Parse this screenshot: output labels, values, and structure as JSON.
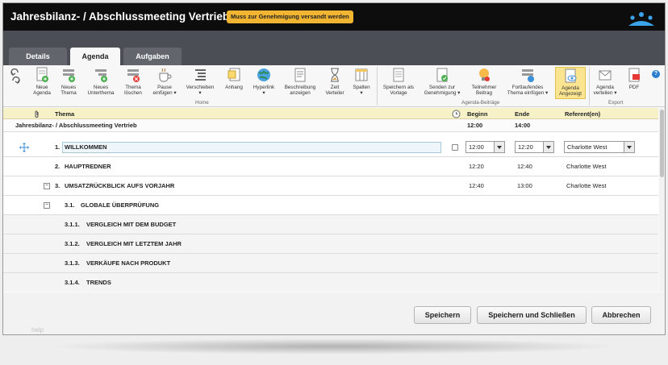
{
  "window": {
    "title": "Jahresbilanz- / Abschlussmeeting Vertrieb",
    "badge": "Muss zur Genehmigung versandt werden"
  },
  "tabs": [
    {
      "label": "Details",
      "active": false
    },
    {
      "label": "Agenda",
      "active": true
    },
    {
      "label": "Aufgaben",
      "active": false
    }
  ],
  "ribbon": {
    "buttons": [
      {
        "label1": "Neue",
        "label2": "Agenda",
        "icon": "new-agenda-icon"
      },
      {
        "label1": "Neues",
        "label2": "Thema",
        "icon": "new-topic-icon"
      },
      {
        "label1": "Neues",
        "label2": "Unterthema",
        "icon": "new-subtopic-icon"
      },
      {
        "label1": "Thema",
        "label2": "löschen",
        "icon": "delete-topic-icon"
      },
      {
        "label1": "Pause",
        "label2": "einfügen ▾",
        "icon": "coffee-break-icon"
      },
      {
        "label1": "Verschieben",
        "label2": "▾",
        "icon": "move-icon"
      },
      {
        "label1": "Anhang",
        "label2": "",
        "icon": "attachment-icon"
      },
      {
        "label1": "Hyperlink",
        "label2": "▾",
        "icon": "hyperlink-globe-icon"
      },
      {
        "label1": "Beschreibung",
        "label2": "anzeigen",
        "icon": "description-icon"
      },
      {
        "label1": "Zeit",
        "label2": "Verteiler",
        "icon": "hourglass-icon"
      },
      {
        "label1": "Spalten",
        "label2": "▾",
        "icon": "columns-icon"
      },
      {
        "label1": "Speichern als",
        "label2": "Vorlage",
        "icon": "save-template-icon"
      },
      {
        "label1": "Senden zur",
        "label2": "Genehmigung ▾",
        "icon": "send-approval-icon"
      },
      {
        "label1": "Teilnehmer",
        "label2": "Beitrag",
        "icon": "participant-bulb-icon"
      },
      {
        "label1": "Fortlaufendes",
        "label2": "Thema einfügen ▾",
        "icon": "recurring-topic-icon"
      },
      {
        "label1": "Agenda",
        "label2": "Angezeigt",
        "icon": "agenda-shown-icon"
      },
      {
        "label1": "Agenda",
        "label2": "verteilen ▾",
        "icon": "distribute-agenda-icon"
      },
      {
        "label1": "PDF",
        "label2": "",
        "icon": "pdf-icon"
      }
    ],
    "groups": {
      "home": "Home",
      "contrib": "Agenda-Beiträge",
      "export": "Export"
    },
    "help": "?"
  },
  "table": {
    "headers": {
      "thema": "Thema",
      "beginn": "Beginn",
      "ende": "Ende",
      "referent": "Referent(en)"
    },
    "meeting": {
      "title": "Jahresbilanz- / Abschlussmeeting Vertrieb",
      "beginn": "12:00",
      "ende": "14:00"
    },
    "rows": [
      {
        "num": "1.",
        "title": "WILLKOMMEN",
        "beginn": "12:00",
        "ende": "12:20",
        "referent": "Charlotte West"
      },
      {
        "num": "2.",
        "title": "HAUPTREDNER",
        "beginn": "12:20",
        "ende": "12:40",
        "referent": "Charlotte West"
      },
      {
        "num": "3.",
        "title": "UMSATZRÜCKBLICK AUFS VORJAHR",
        "beginn": "12:40",
        "ende": "13:00",
        "referent": "Charlotte West"
      },
      {
        "num": "3.1.",
        "title": "GLOBALE ÜBERPRÜFUNG"
      },
      {
        "num": "3.1.1.",
        "title": "VERGLEICH MIT DEM BUDGET"
      },
      {
        "num": "3.1.2.",
        "title": "VERGLEICH MIT LETZTEM JAHR"
      },
      {
        "num": "3.1.3.",
        "title": "VERKÄUFE NACH PRODUKT"
      },
      {
        "num": "3.1.4.",
        "title": "TRENDS"
      }
    ]
  },
  "footer": {
    "save": "Speichern",
    "save_close": "Speichern und Schließen",
    "cancel": "Abbrechen",
    "help": "help"
  }
}
